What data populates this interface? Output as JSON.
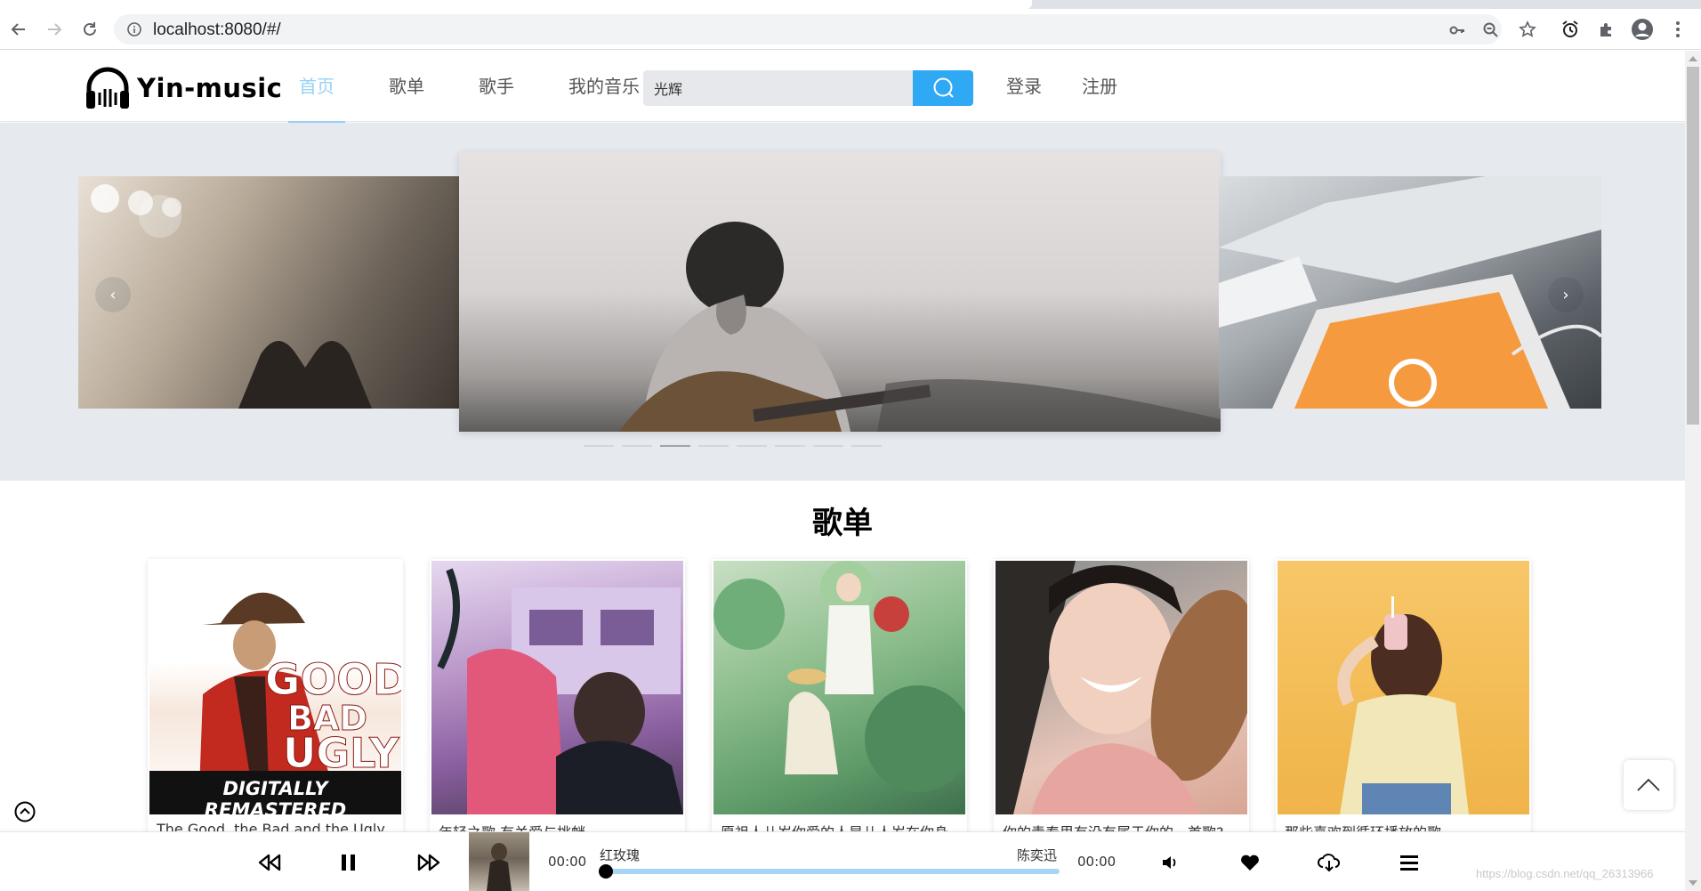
{
  "browser": {
    "url": "localhost:8080/#/"
  },
  "site": {
    "brand": "Yin-music",
    "nav": [
      {
        "label": "首页",
        "active": true
      },
      {
        "label": "歌单",
        "active": false
      },
      {
        "label": "歌手",
        "active": false
      },
      {
        "label": "我的音乐",
        "active": false
      }
    ],
    "search": {
      "value": "光辉"
    },
    "auth": {
      "login": "登录",
      "register": "注册"
    }
  },
  "carousel": {
    "prev": "‹",
    "next": "›",
    "slide_count": 8,
    "active_index": 2
  },
  "playlists": {
    "title": "歌单",
    "items": [
      {
        "caption": "The Good, the Bad and the Ugly",
        "cover_text": "DIGITALLY REMASTERED"
      },
      {
        "caption": "年轻之歌 有关爱与挑衅"
      },
      {
        "caption": "愿祖人儿岁你爱的人是儿人岁在你身"
      },
      {
        "caption": "你的青春里有没有属于你的一首歌?"
      },
      {
        "caption": "那些喜欢到循环播放的歌"
      }
    ]
  },
  "player": {
    "current_time": "00:00",
    "total_time": "00:00",
    "song_title": "红玫瑰",
    "artist": "陈奕迅",
    "progress": 0
  },
  "watermark": "https://blog.csdn.net/qq_26313966",
  "colors": {
    "accent": "#30a9f5",
    "nav_active": "#95d2f6",
    "carousel_bg": "#e6eaef",
    "progress": "#a6d6f4"
  }
}
